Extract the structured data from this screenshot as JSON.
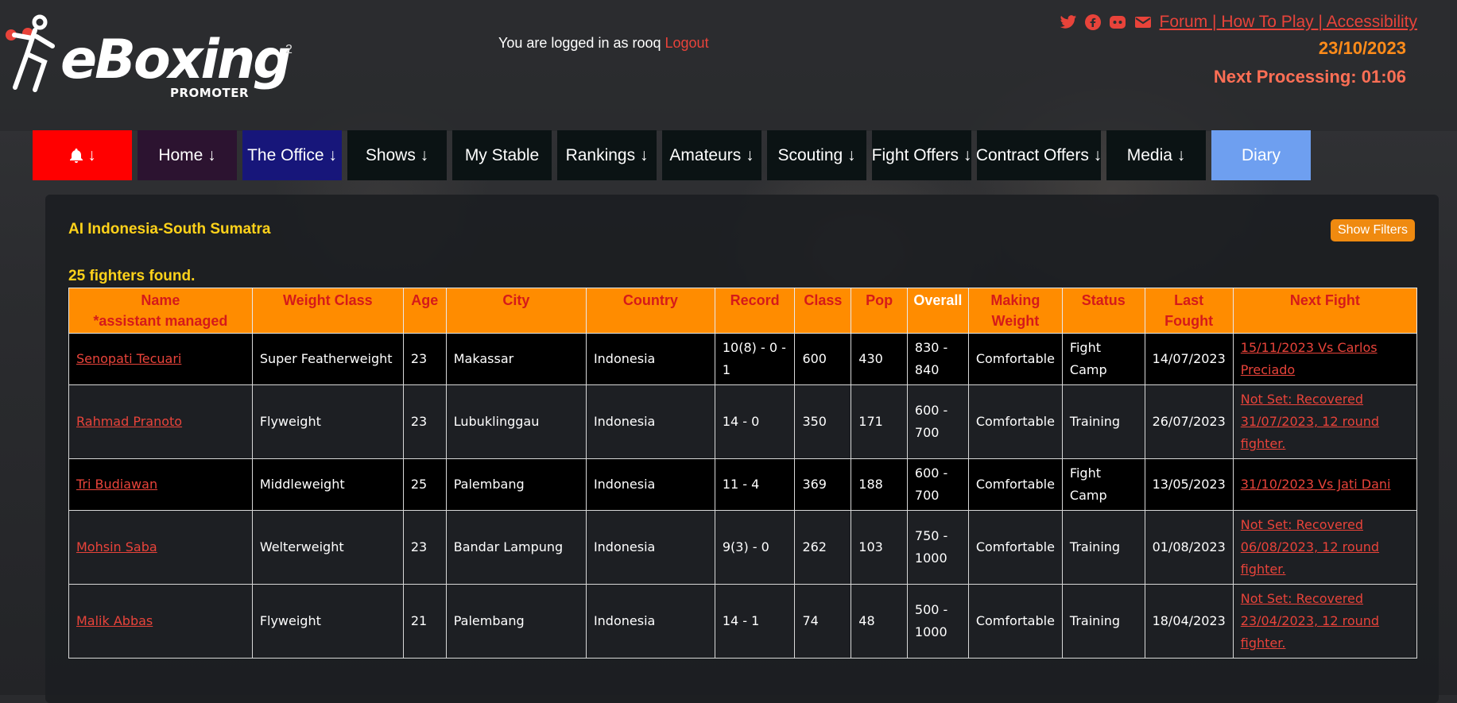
{
  "header": {
    "logo_text": "eBoxing",
    "logo_sub": "PROMOTER",
    "logo_sup": "2",
    "login_text": "You are logged in as rooq",
    "logout_label": "Logout",
    "links": "Forum | How To Play | Accessibility",
    "date": "23/10/2023",
    "next_processing": "Next Processing: 01:06",
    "accent_color": "#e8433a"
  },
  "nav": {
    "alerts": "↓",
    "home": "Home ↓",
    "office": "The Office ↓",
    "shows": "Shows ↓",
    "stable": "My Stable",
    "rankings": "Rankings ↓",
    "amateurs": "Amateurs ↓",
    "scouting": "Scouting ↓",
    "fight_offers": "Fight Offers ↓",
    "contract_offers": "Contract Offers ↓",
    "media": "Media ↓",
    "diary": "Diary"
  },
  "panel": {
    "title": "AI Indonesia-South Sumatra",
    "filters_label": "Show Filters",
    "found_text": "25 fighters found."
  },
  "table": {
    "headers": {
      "name": "Name",
      "name_note": "*assistant managed",
      "weight_class": "Weight Class",
      "age": "Age",
      "city": "City",
      "country": "Country",
      "record": "Record",
      "class": "Class",
      "pop": "Pop",
      "overall": "Overall",
      "making_weight": "Making Weight",
      "status": "Status",
      "last_fought": "Last Fought",
      "next_fight": "Next Fight"
    },
    "rows": [
      {
        "name": "Senopati Tecuari",
        "weight_class": "Super Featherweight",
        "age": "23",
        "city": "Makassar",
        "country": "Indonesia",
        "record": "10(8) - 0 - 1",
        "class": "600",
        "pop": "430",
        "overall": "830 - 840",
        "making_weight": "Comfortable",
        "status": "Fight Camp",
        "last_fought": "14/07/2023",
        "next_fight": "15/11/2023 Vs Carlos Preciado"
      },
      {
        "name": "Rahmad Pranoto",
        "weight_class": "Flyweight",
        "age": "23",
        "city": "Lubuklinggau",
        "country": "Indonesia",
        "record": "14 - 0",
        "class": "350",
        "pop": "171",
        "overall": "600 - 700",
        "making_weight": "Comfortable",
        "status": "Training",
        "last_fought": "26/07/2023",
        "next_fight": "Not Set: Recovered 31/07/2023, 12 round fighter."
      },
      {
        "name": "Tri Budiawan",
        "weight_class": "Middleweight",
        "age": "25",
        "city": "Palembang",
        "country": "Indonesia",
        "record": "11 - 4",
        "class": "369",
        "pop": "188",
        "overall": "600 - 700",
        "making_weight": "Comfortable",
        "status": "Fight Camp",
        "last_fought": "13/05/2023",
        "next_fight": "31/10/2023 Vs Jati Dani"
      },
      {
        "name": "Mohsin Saba",
        "weight_class": "Welterweight",
        "age": "23",
        "city": "Bandar Lampung",
        "country": "Indonesia",
        "record": "9(3) - 0",
        "class": "262",
        "pop": "103",
        "overall": "750 - 1000",
        "making_weight": "Comfortable",
        "status": "Training",
        "last_fought": "01/08/2023",
        "next_fight": "Not Set: Recovered 06/08/2023, 12 round fighter."
      },
      {
        "name": "Malik Abbas",
        "weight_class": "Flyweight",
        "age": "21",
        "city": "Palembang",
        "country": "Indonesia",
        "record": "14 - 1",
        "class": "74",
        "pop": "48",
        "overall": "500 - 1000",
        "making_weight": "Comfortable",
        "status": "Training",
        "last_fought": "18/04/2023",
        "next_fight": "Not Set: Recovered 23/04/2023, 12 round fighter."
      }
    ]
  }
}
